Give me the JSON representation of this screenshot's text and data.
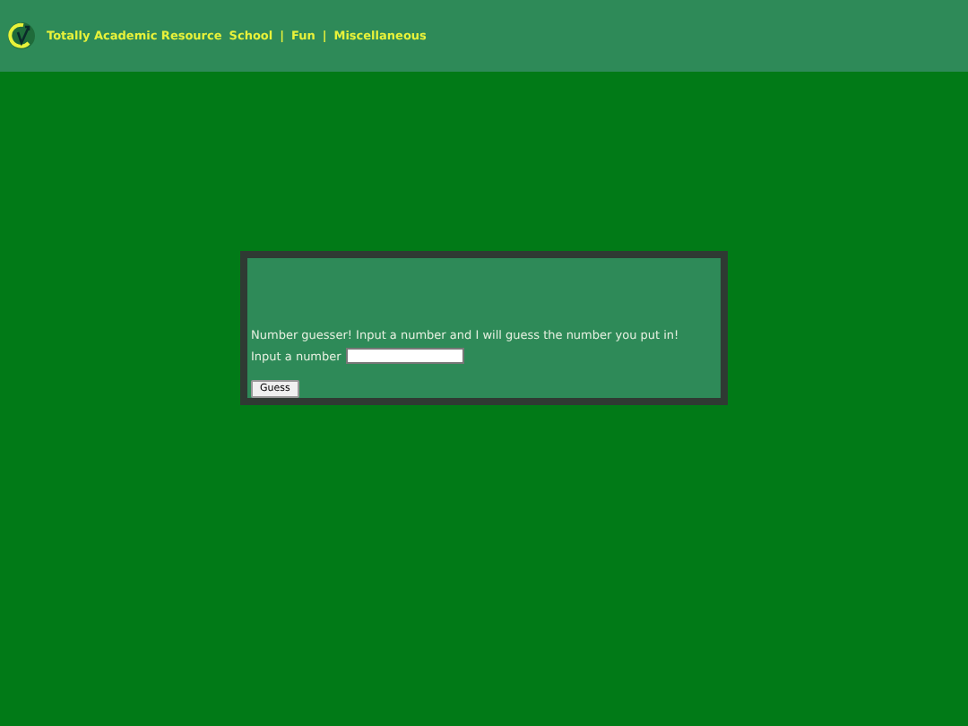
{
  "header": {
    "site_title": "Totally Academic Resource",
    "nav": [
      {
        "label": "School",
        "separator": "|"
      },
      {
        "label": "Fun",
        "separator": "|"
      },
      {
        "label": "Miscellaneous"
      }
    ]
  },
  "panel": {
    "intro": "Number guesser! Input a number and I will guess the number you put in!",
    "field_label": "Input a number",
    "button": "Guess"
  }
}
